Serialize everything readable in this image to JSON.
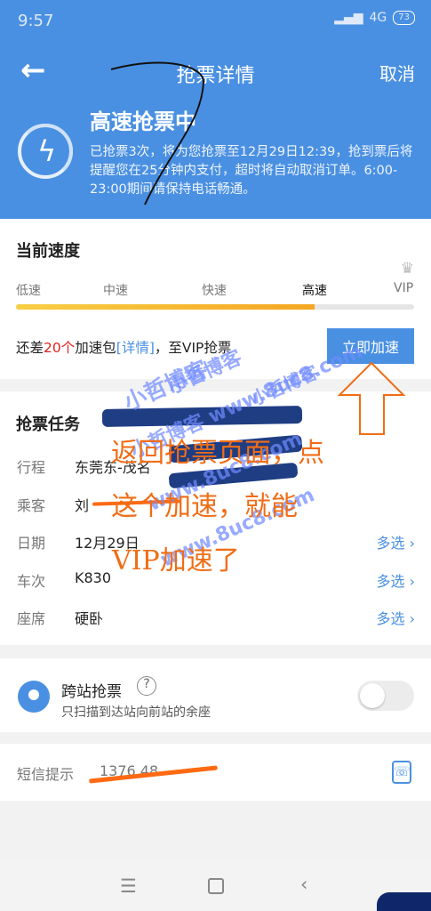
{
  "status_bar": {
    "time": "9:57",
    "network": "4G",
    "battery": "73"
  },
  "header": {
    "back_icon": "arrow-left-icon",
    "title": "抢票详情",
    "cancel": "取消"
  },
  "rush": {
    "status_title": "高速抢票中",
    "description": "已抢票3次，将为您抢票至12月29日12:39，抢到票后将提醒您在25分钟内支付，超时将自动取消订单。6:00-23:00期间请保持电话畅通。"
  },
  "speed": {
    "title": "当前速度",
    "levels": [
      "低速",
      "中速",
      "快速",
      "高速",
      "VIP"
    ],
    "progress": 0.75,
    "vip_prefix": "还差",
    "vip_count": "20个",
    "vip_mid": "加速包",
    "vip_link": "[详情]",
    "vip_suffix": "，至VIP抢票",
    "button": "立即加速"
  },
  "task": {
    "title": "抢票任务",
    "rows": [
      {
        "label": "行程",
        "value": "东莞东-茂名"
      },
      {
        "label": "乘客",
        "value": "刘"
      },
      {
        "label": "日期",
        "value": "12月29日",
        "action": "多选 ›"
      },
      {
        "label": "车次",
        "value": "K830",
        "action": "多选 ›"
      },
      {
        "label": "座席",
        "value": "硬卧",
        "action": "多选 ›"
      }
    ]
  },
  "transfer": {
    "title": "跨站抢票",
    "help": "?",
    "desc": "只扫描到达站向前站的余座",
    "enabled": false
  },
  "sms": {
    "label": "短信提示",
    "number": "1376  48"
  },
  "watermarks": [
    "小哲博客",
    "小哲博客",
    "小哲博客",
    "小哲博客 www.8uc8.com",
    "www.8uc8.com",
    "www.8uc8.com"
  ],
  "annotation_lines": [
    "返回抢票页面，点",
    "这个加速，就能",
    "VIP加速了"
  ],
  "nav": {
    "menu": "☰",
    "home": "□",
    "back": "‹"
  },
  "colors": {
    "primary": "#4a90e2",
    "red": "#e02020",
    "annotation": "#f06d16"
  }
}
